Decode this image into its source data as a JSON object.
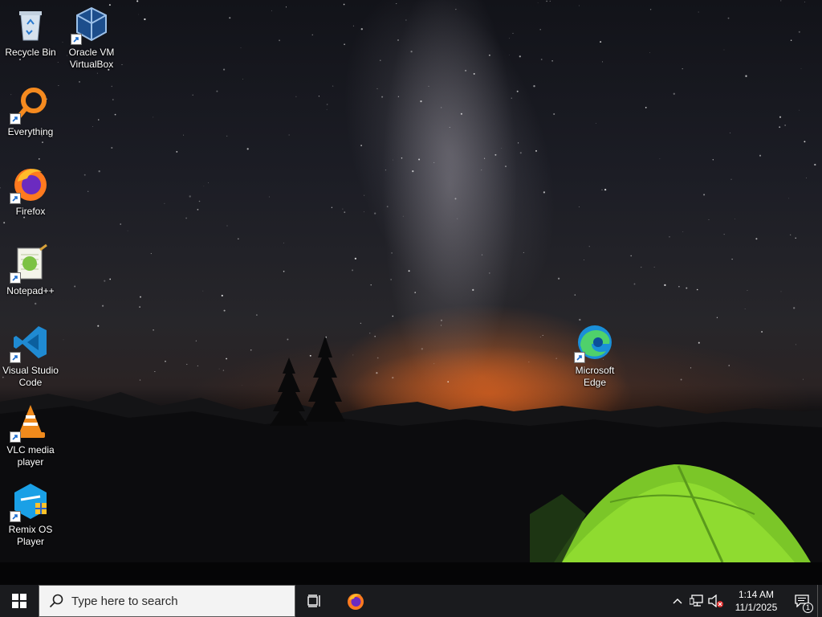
{
  "desktop": {
    "icons": [
      {
        "label": "Recycle Bin",
        "icon": "recycle-bin-icon"
      },
      {
        "label": "Oracle VM\nVirtualBox",
        "icon": "virtualbox-icon"
      },
      {
        "label": "Everything",
        "icon": "everything-search-icon"
      },
      {
        "label": "Firefox",
        "icon": "firefox-icon"
      },
      {
        "label": "Notepad++",
        "icon": "notepadpp-icon"
      },
      {
        "label": "Visual Studio\nCode",
        "icon": "vscode-icon"
      },
      {
        "label": "VLC media\nplayer",
        "icon": "vlc-icon"
      },
      {
        "label": "Remix OS\nPlayer",
        "icon": "remix-os-icon"
      },
      {
        "label": "Microsoft\nEdge",
        "icon": "edge-icon"
      }
    ]
  },
  "taskbar": {
    "search_placeholder": "Type here to search",
    "clock_time": "1:14 AM",
    "clock_date": "11/1/2025",
    "notification_count": "1"
  },
  "colors": {
    "taskbar_bg": "#1a1b1e",
    "accent": "#0078d7"
  }
}
